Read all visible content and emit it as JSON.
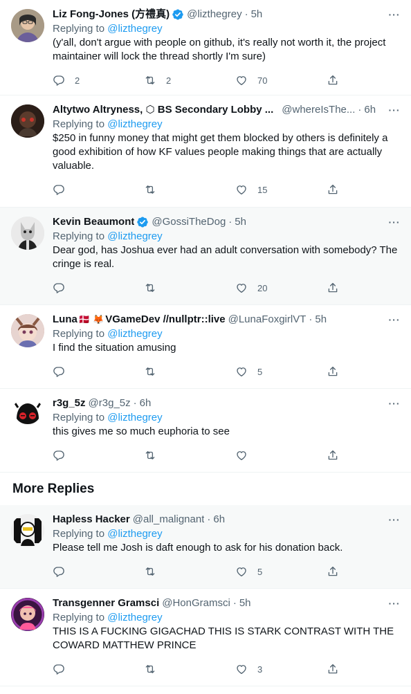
{
  "replying_label": "Replying to",
  "more_replies_title": "More Replies",
  "more_icon": "more-dots-icon",
  "tweets": [
    {
      "name": "Liz Fong-Jones (方禮真)",
      "verified": true,
      "handle": "@lizthegrey",
      "time": "5h",
      "reply_to": "@lizthegrey",
      "text": "(y'all, don't argue with people on github, it's really not worth it, the project maintainer will lock the thread shortly I'm sure)",
      "replies": "2",
      "retweets": "2",
      "likes": "70",
      "avatar_color": "#c9b39a"
    },
    {
      "name": "Altytwo Altryness, ⬡ BS Secondary Lobby ...",
      "verified": false,
      "handle": "@whereIsThe...",
      "time": "6h",
      "reply_to": "@lizthegrey",
      "text": "$250 in funny money that might get them blocked by others is definitely a good exhibition of how KF values people making things that are actually valuable.",
      "replies": "",
      "retweets": "",
      "likes": "15",
      "avatar_color": "#3a2a22"
    },
    {
      "name": "Kevin Beaumont",
      "verified": true,
      "handle": "@GossiTheDog",
      "time": "5h",
      "reply_to": "@lizthegrey",
      "text": "Dear god, has Joshua ever had an adult conversation with somebody? The cringe is real.",
      "replies": "",
      "retweets": "",
      "likes": "20",
      "avatar_color": "#d9d9d9"
    },
    {
      "name": "Luna",
      "flag": "🇩🇰",
      "fox": "🦊",
      "name2": "VGameDev //nullptr::live",
      "verified": false,
      "handle": "@LunaFoxgirlVT",
      "time": "5h",
      "reply_to": "@lizthegrey",
      "text": "I find the situation amusing",
      "replies": "",
      "retweets": "",
      "likes": "5",
      "avatar_color": "#b98a7c"
    },
    {
      "name": "r3g_5z",
      "verified": false,
      "handle": "@r3g_5z",
      "time": "6h",
      "reply_to": "@lizthegrey",
      "text": "this gives me so much euphoria to see",
      "replies": "",
      "retweets": "",
      "likes": "",
      "avatar_color": "#111111"
    },
    {
      "name": "Hapless Hacker",
      "verified": false,
      "handle": "@all_malignant",
      "time": "6h",
      "reply_to": "@lizthegrey",
      "text": "Please tell me Josh is daft enough to ask for his donation back.",
      "replies": "",
      "retweets": "",
      "likes": "5",
      "avatar_color": "#e8e8e8"
    },
    {
      "name": "Transgenner Gramsci",
      "verified": false,
      "handle": "@HonGramsci",
      "time": "5h",
      "reply_to": "@lizthegrey",
      "text": "THIS IS A FUCKING GIGACHAD THIS IS STARK CONTRAST WITH THE COWARD MATTHEW PRINCE",
      "replies": "",
      "retweets": "",
      "likes": "3",
      "avatar_color": "#5a2a6a"
    }
  ],
  "colors": {
    "link": "#1d9bf0",
    "muted": "#536471",
    "text": "#0f1419",
    "highlight_bg": "#f7f9f9"
  }
}
